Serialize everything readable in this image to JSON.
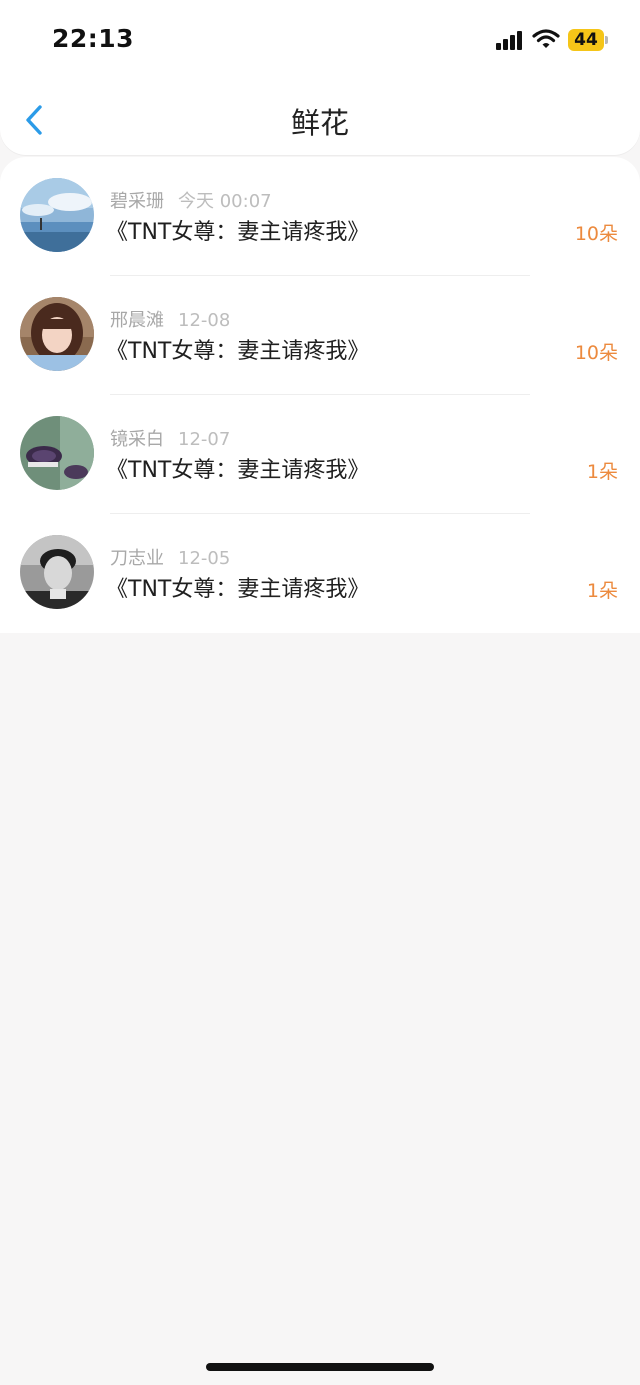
{
  "status_bar": {
    "time": "22:13",
    "battery": "44",
    "icons": [
      "signal-icon",
      "wifi-icon",
      "battery-icon"
    ]
  },
  "header": {
    "title": "鲜花",
    "back_icon": "chevron-left-icon"
  },
  "colors": {
    "accent_blue": "#2b9be8",
    "count_orange": "#ec8a3e",
    "battery_yellow": "#f5c518"
  },
  "flowers": [
    {
      "name": "碧采珊",
      "date": "今天 00:07",
      "book": "《TNT女尊：妻主请疼我》",
      "count": "10朵"
    },
    {
      "name": "邢晨滩",
      "date": "12-08",
      "book": "《TNT女尊：妻主请疼我》",
      "count": "10朵"
    },
    {
      "name": "镜采白",
      "date": "12-07",
      "book": "《TNT女尊：妻主请疼我》",
      "count": "1朵"
    },
    {
      "name": "刀志业",
      "date": "12-05",
      "book": "《TNT女尊：妻主请疼我》",
      "count": "1朵"
    }
  ]
}
